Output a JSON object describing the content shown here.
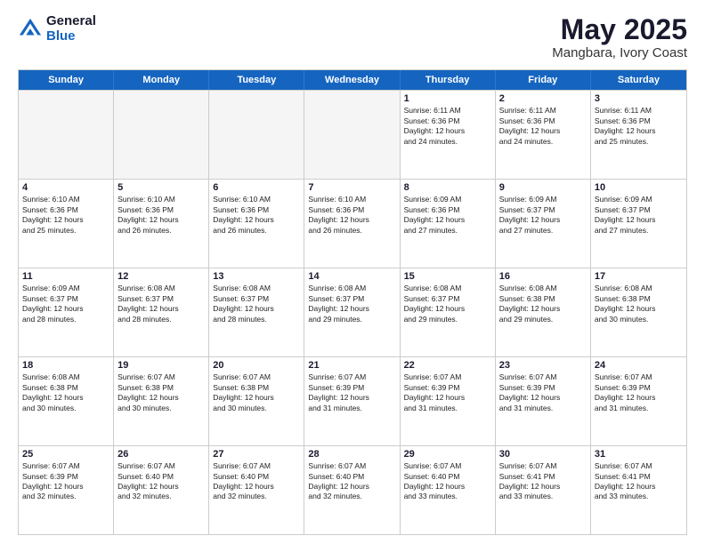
{
  "header": {
    "logo_general": "General",
    "logo_blue": "Blue",
    "title": "May 2025",
    "location": "Mangbara, Ivory Coast"
  },
  "weekdays": [
    "Sunday",
    "Monday",
    "Tuesday",
    "Wednesday",
    "Thursday",
    "Friday",
    "Saturday"
  ],
  "rows": [
    [
      {
        "day": "",
        "info": ""
      },
      {
        "day": "",
        "info": ""
      },
      {
        "day": "",
        "info": ""
      },
      {
        "day": "",
        "info": ""
      },
      {
        "day": "1",
        "info": "Sunrise: 6:11 AM\nSunset: 6:36 PM\nDaylight: 12 hours\nand 24 minutes."
      },
      {
        "day": "2",
        "info": "Sunrise: 6:11 AM\nSunset: 6:36 PM\nDaylight: 12 hours\nand 24 minutes."
      },
      {
        "day": "3",
        "info": "Sunrise: 6:11 AM\nSunset: 6:36 PM\nDaylight: 12 hours\nand 25 minutes."
      }
    ],
    [
      {
        "day": "4",
        "info": "Sunrise: 6:10 AM\nSunset: 6:36 PM\nDaylight: 12 hours\nand 25 minutes."
      },
      {
        "day": "5",
        "info": "Sunrise: 6:10 AM\nSunset: 6:36 PM\nDaylight: 12 hours\nand 26 minutes."
      },
      {
        "day": "6",
        "info": "Sunrise: 6:10 AM\nSunset: 6:36 PM\nDaylight: 12 hours\nand 26 minutes."
      },
      {
        "day": "7",
        "info": "Sunrise: 6:10 AM\nSunset: 6:36 PM\nDaylight: 12 hours\nand 26 minutes."
      },
      {
        "day": "8",
        "info": "Sunrise: 6:09 AM\nSunset: 6:36 PM\nDaylight: 12 hours\nand 27 minutes."
      },
      {
        "day": "9",
        "info": "Sunrise: 6:09 AM\nSunset: 6:37 PM\nDaylight: 12 hours\nand 27 minutes."
      },
      {
        "day": "10",
        "info": "Sunrise: 6:09 AM\nSunset: 6:37 PM\nDaylight: 12 hours\nand 27 minutes."
      }
    ],
    [
      {
        "day": "11",
        "info": "Sunrise: 6:09 AM\nSunset: 6:37 PM\nDaylight: 12 hours\nand 28 minutes."
      },
      {
        "day": "12",
        "info": "Sunrise: 6:08 AM\nSunset: 6:37 PM\nDaylight: 12 hours\nand 28 minutes."
      },
      {
        "day": "13",
        "info": "Sunrise: 6:08 AM\nSunset: 6:37 PM\nDaylight: 12 hours\nand 28 minutes."
      },
      {
        "day": "14",
        "info": "Sunrise: 6:08 AM\nSunset: 6:37 PM\nDaylight: 12 hours\nand 29 minutes."
      },
      {
        "day": "15",
        "info": "Sunrise: 6:08 AM\nSunset: 6:37 PM\nDaylight: 12 hours\nand 29 minutes."
      },
      {
        "day": "16",
        "info": "Sunrise: 6:08 AM\nSunset: 6:38 PM\nDaylight: 12 hours\nand 29 minutes."
      },
      {
        "day": "17",
        "info": "Sunrise: 6:08 AM\nSunset: 6:38 PM\nDaylight: 12 hours\nand 30 minutes."
      }
    ],
    [
      {
        "day": "18",
        "info": "Sunrise: 6:08 AM\nSunset: 6:38 PM\nDaylight: 12 hours\nand 30 minutes."
      },
      {
        "day": "19",
        "info": "Sunrise: 6:07 AM\nSunset: 6:38 PM\nDaylight: 12 hours\nand 30 minutes."
      },
      {
        "day": "20",
        "info": "Sunrise: 6:07 AM\nSunset: 6:38 PM\nDaylight: 12 hours\nand 30 minutes."
      },
      {
        "day": "21",
        "info": "Sunrise: 6:07 AM\nSunset: 6:39 PM\nDaylight: 12 hours\nand 31 minutes."
      },
      {
        "day": "22",
        "info": "Sunrise: 6:07 AM\nSunset: 6:39 PM\nDaylight: 12 hours\nand 31 minutes."
      },
      {
        "day": "23",
        "info": "Sunrise: 6:07 AM\nSunset: 6:39 PM\nDaylight: 12 hours\nand 31 minutes."
      },
      {
        "day": "24",
        "info": "Sunrise: 6:07 AM\nSunset: 6:39 PM\nDaylight: 12 hours\nand 31 minutes."
      }
    ],
    [
      {
        "day": "25",
        "info": "Sunrise: 6:07 AM\nSunset: 6:39 PM\nDaylight: 12 hours\nand 32 minutes."
      },
      {
        "day": "26",
        "info": "Sunrise: 6:07 AM\nSunset: 6:40 PM\nDaylight: 12 hours\nand 32 minutes."
      },
      {
        "day": "27",
        "info": "Sunrise: 6:07 AM\nSunset: 6:40 PM\nDaylight: 12 hours\nand 32 minutes."
      },
      {
        "day": "28",
        "info": "Sunrise: 6:07 AM\nSunset: 6:40 PM\nDaylight: 12 hours\nand 32 minutes."
      },
      {
        "day": "29",
        "info": "Sunrise: 6:07 AM\nSunset: 6:40 PM\nDaylight: 12 hours\nand 33 minutes."
      },
      {
        "day": "30",
        "info": "Sunrise: 6:07 AM\nSunset: 6:41 PM\nDaylight: 12 hours\nand 33 minutes."
      },
      {
        "day": "31",
        "info": "Sunrise: 6:07 AM\nSunset: 6:41 PM\nDaylight: 12 hours\nand 33 minutes."
      }
    ]
  ]
}
